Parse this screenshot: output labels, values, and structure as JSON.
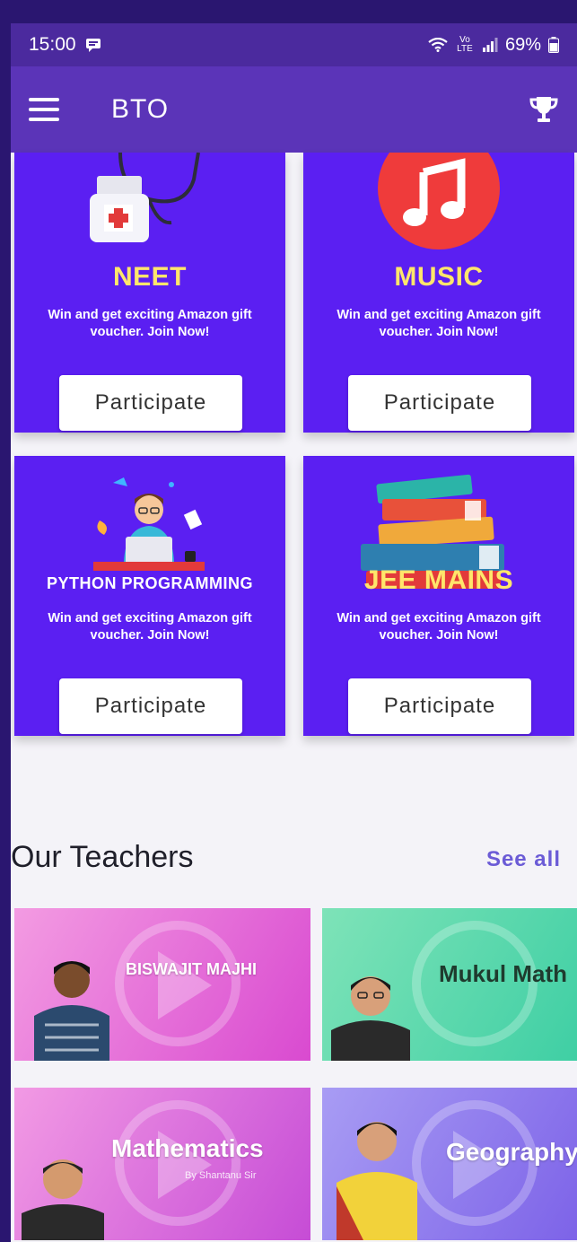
{
  "status_bar": {
    "time": "15:00",
    "network": "Vo LTE",
    "battery": "69%"
  },
  "app_bar": {
    "title": "BTO"
  },
  "quizzes": [
    {
      "category": "NEET",
      "description": "Win and get exciting Amazon gift voucher. Join Now!",
      "button": "Participate"
    },
    {
      "category": "MUSIC",
      "description": "Win and get exciting Amazon gift voucher. Join Now!",
      "button": "Participate"
    },
    {
      "category": "PYTHON PROGRAMMING",
      "description": "Win and get exciting Amazon gift voucher. Join Now!",
      "button": "Participate"
    },
    {
      "category": "JEE MAINS",
      "description": "Win and get exciting Amazon gift voucher. Join Now!",
      "button": "Participate"
    }
  ],
  "teachers_section": {
    "title": "Our Teachers",
    "see_all": "See all"
  },
  "teachers": [
    {
      "name": "BISWAJIT MAJHI",
      "subtitle": ""
    },
    {
      "name": "Mukul Math",
      "subtitle": ""
    },
    {
      "name": "Mathematics",
      "subtitle": "By Shantanu Sir"
    },
    {
      "name": "Geography",
      "subtitle": ""
    }
  ],
  "colors": {
    "status_bar": "#4b2a9e",
    "app_bar": "#5b34b8",
    "card": "#5b1ff2",
    "category_text": "#ffe66b",
    "see_all": "#6b5bd6"
  }
}
